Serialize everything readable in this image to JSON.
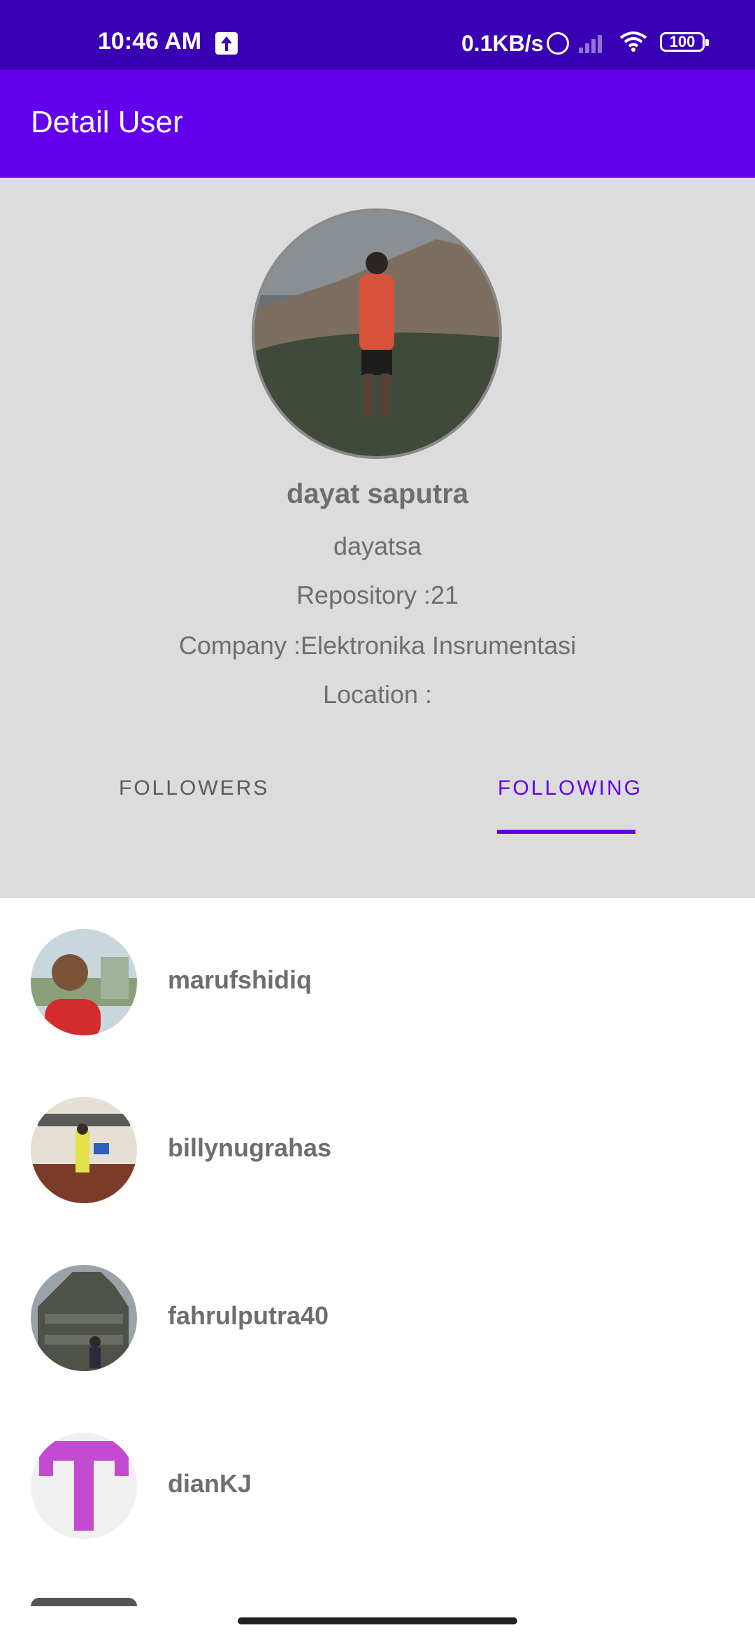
{
  "status_bar": {
    "time": "10:46 AM",
    "net_speed": "0.1KB/s",
    "battery": "100",
    "icons": [
      "upload-icon",
      "alarm-icon",
      "signal-icon",
      "wifi-icon",
      "battery-icon"
    ]
  },
  "app_bar": {
    "title": "Detail User"
  },
  "profile": {
    "name": "dayat saputra",
    "username": "dayatsa",
    "repository": "Repository :21",
    "company": "Company :Elektronika Insrumentasi",
    "location": "Location :"
  },
  "tabs": {
    "followers": "FOLLOWERS",
    "following": "FOLLOWING",
    "selected": "following"
  },
  "following": [
    {
      "login": "marufshidiq"
    },
    {
      "login": "billynugrahas"
    },
    {
      "login": "fahrulputra40"
    },
    {
      "login": "dianKJ"
    }
  ],
  "colors": {
    "status_bar": "#3a00b3",
    "app_bar": "#6200ee",
    "accent": "#6200ee",
    "profile_bg": "#dcdcdc"
  }
}
